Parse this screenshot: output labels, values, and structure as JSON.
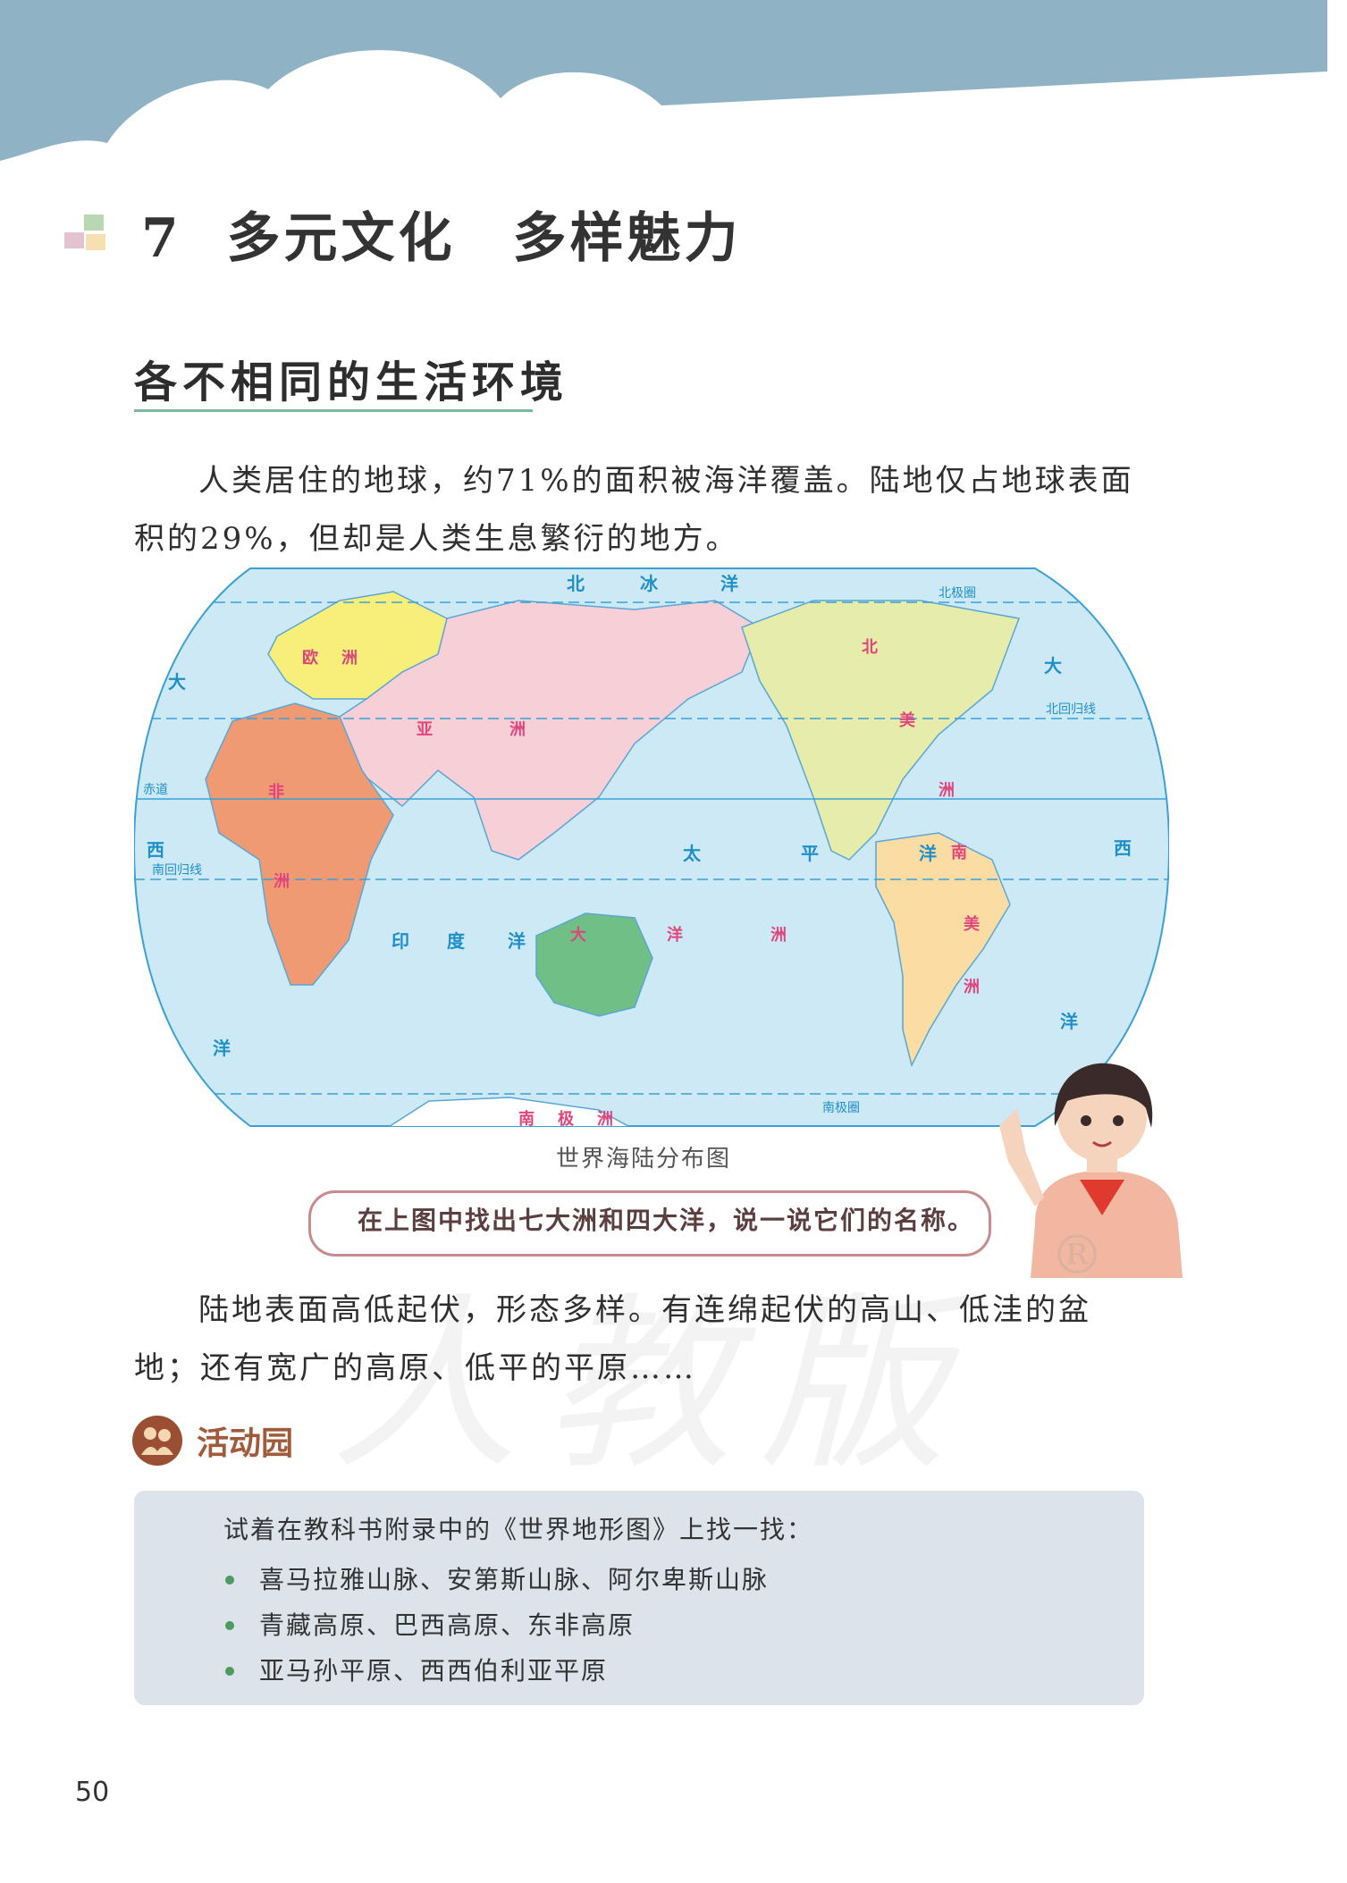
{
  "lesson": {
    "number": "7",
    "title": "多元文化　多样魅力"
  },
  "section": {
    "title": "各不相同的生活环境"
  },
  "paragraphs": [
    "人类居住的地球，约71%的面积被海洋覆盖。陆地仅占地球表面积的29%，但却是人类生息繁衍的地方。",
    "陆地表面高低起伏，形态多样。有连绵起伏的高山、低洼的盆地；还有宽广的高原、低平的平原……"
  ],
  "map": {
    "caption": "世界海陆分布图",
    "oceans": {
      "arctic": [
        "北",
        "冰",
        "洋"
      ],
      "atlantic_left": [
        "大",
        "西",
        "洋"
      ],
      "pacific": [
        "太",
        "平",
        "洋"
      ],
      "indian": [
        "印",
        "度",
        "洋"
      ],
      "atlantic_right": [
        "大",
        "西",
        "洋"
      ]
    },
    "continents": {
      "europe": [
        "欧",
        "洲"
      ],
      "asia": [
        "亚",
        "洲"
      ],
      "africa": [
        "非",
        "洲"
      ],
      "oceania": [
        "大",
        "洋",
        "洲"
      ],
      "north_america": [
        "北",
        "美",
        "洲"
      ],
      "south_america": [
        "南",
        "美",
        "洲"
      ],
      "antarctica": [
        "南",
        "极",
        "洲"
      ]
    },
    "lines": {
      "arctic_circle": "北极圈",
      "tropic_cancer": "北回归线",
      "equator": "赤道",
      "tropic_capricorn": "南回归线",
      "antarctic_circle": "南极圈"
    },
    "colors": {
      "ocean": "#cde9f6",
      "asia": "#f6cfd7",
      "europe": "#f8ef7a",
      "africa": "#ef9a73",
      "oceania": "#6fbf86",
      "north_america": "#e6ecaa",
      "south_america": "#fbdca3",
      "label_ocean": "#1f8fc8",
      "label_land": "#e0457b"
    }
  },
  "prompt": {
    "text": "在上图中找出七大洲和四大洋，说一说它们的名称。"
  },
  "watermark": {
    "text": "人教版",
    "mark": "®"
  },
  "activity": {
    "title": "活动园",
    "intro": "试着在教科书附录中的《世界地形图》上找一找：",
    "items": [
      "喜马拉雅山脉、安第斯山脉、阿尔卑斯山脉",
      "青藏高原、巴西高原、东非高原",
      "亚马孙平原、西西伯利亚平原"
    ]
  },
  "page_number": "50"
}
